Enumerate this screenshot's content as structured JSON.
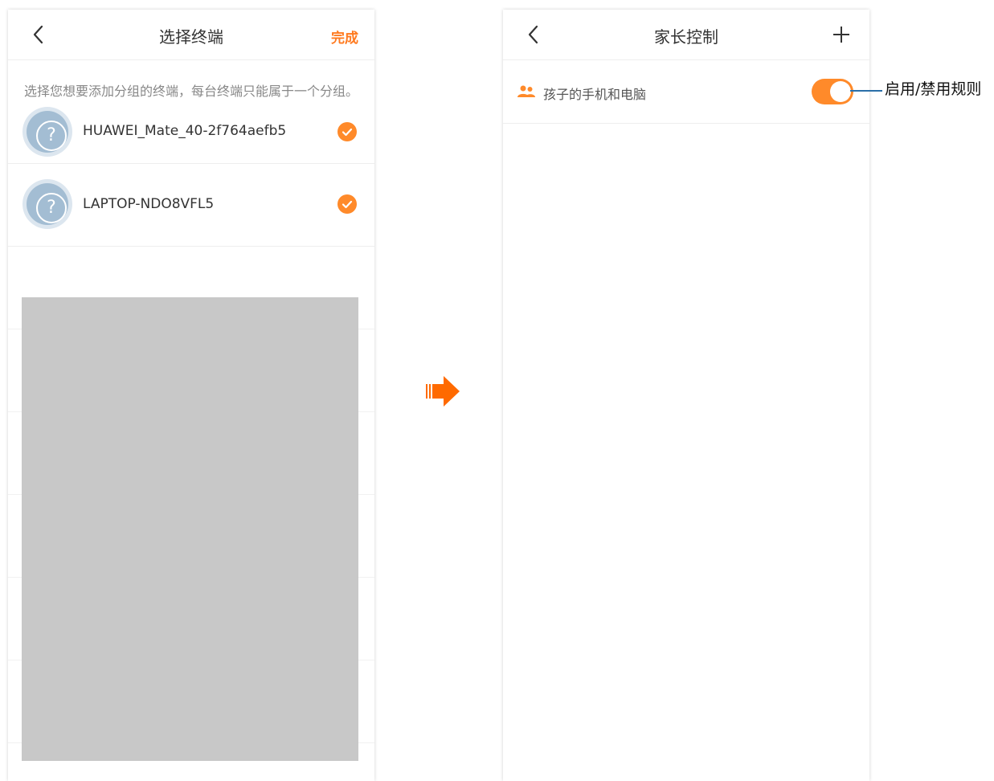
{
  "left_screen": {
    "title": "选择终端",
    "done_label": "完成",
    "hint": "选择您想要添加分组的终端，每台终端只能属于一个分组。",
    "devices": [
      {
        "name": "HUAWEI_Mate_40-2f764aefb5",
        "icon": "unknown-device-icon",
        "checked": true
      },
      {
        "name": "LAPTOP-NDO8VFL5",
        "icon": "unknown-device-icon",
        "checked": true
      }
    ]
  },
  "right_screen": {
    "title": "家长控制",
    "add_icon": "plus-icon",
    "rules": [
      {
        "name": "孩子的手机和电脑",
        "icon": "group-icon",
        "enabled": true
      }
    ]
  },
  "callout": {
    "text": "启用/禁用规则"
  },
  "colors": {
    "accent": "#ff7a1f",
    "arrow": "#ff6a00",
    "placeholder_gray": "#c8c8c8"
  }
}
